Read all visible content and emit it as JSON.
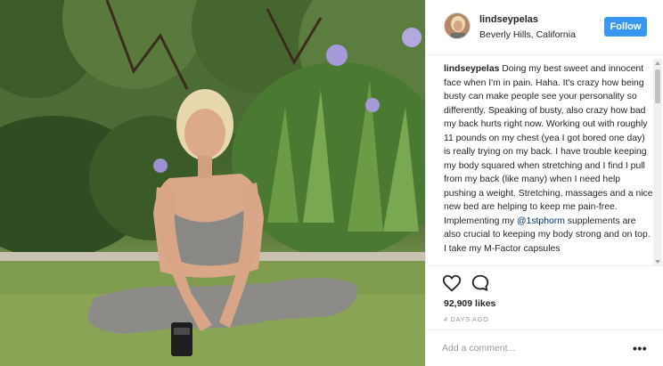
{
  "post": {
    "username": "lindseypelas",
    "location": "Beverly Hills, California",
    "follow_label": "Follow",
    "caption_user": "lindseypelas",
    "caption_text_1": " Doing my best sweet and innocent face when I'm in pain. Haha. It's crazy how being busty can make people see your personality so differently. Speaking of busty, also crazy how bad my back hurts right now. Working out with roughly 11 pounds on my chest (yea I got bored one day) is really trying on my back. I have trouble keeping my body squared when stretching and I find I pull from my back (like many) when I need help pushing a weight. Stretching, massages and a nice new bed are helping to keep me pain-free. Implementing my ",
    "caption_mention": "@1stphorm",
    "caption_text_2": " supplements are also crucial to keeping my body strong and on top. I take my M-Factor capsules",
    "likes": "92,909 likes",
    "timestamp": "4 DAYS AGO",
    "comment_placeholder": "Add a comment...",
    "more_label": "•••"
  },
  "icons": {
    "like": "heart-icon",
    "comment": "speech-bubble-icon",
    "more": "ellipsis-icon"
  },
  "colors": {
    "follow_button": "#3897f0",
    "text": "#262626",
    "muted": "#999999"
  }
}
